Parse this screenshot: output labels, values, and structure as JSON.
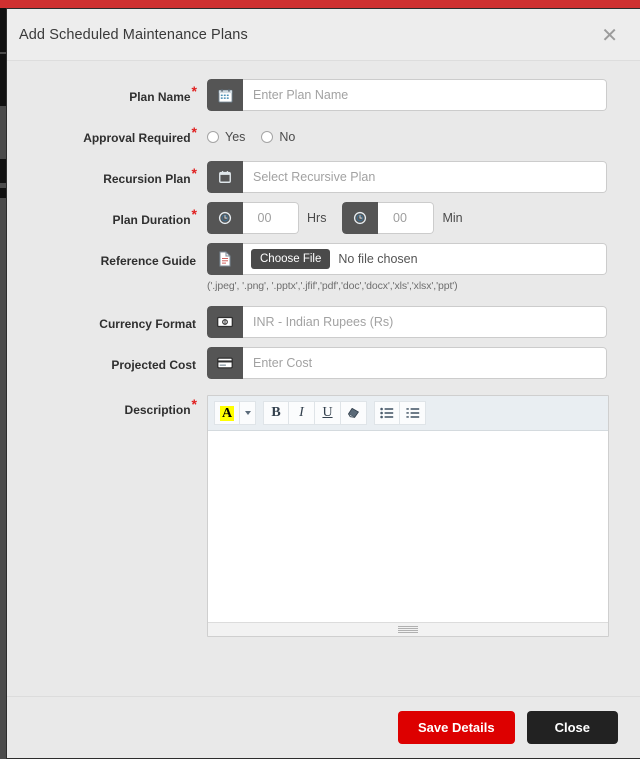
{
  "window": {
    "accent_color": "#cf3030",
    "modal_bg": "#e9e9e9"
  },
  "header": {
    "title": "Add Scheduled Maintenance Plans",
    "close_icon": "close-icon",
    "close_glyph": "✕"
  },
  "form": {
    "plan_name": {
      "label": "Plan Name",
      "required": "*",
      "icon": "calendar-icon",
      "placeholder": "Enter Plan Name",
      "value": ""
    },
    "approval_required": {
      "label": "Approval Required",
      "required": "*",
      "options": [
        {
          "label": "Yes",
          "selected": false
        },
        {
          "label": "No",
          "selected": false
        }
      ]
    },
    "recursion_plan": {
      "label": "Recursion Plan",
      "required": "*",
      "icon": "calendar-icon",
      "placeholder": "Select Recursive Plan",
      "value": ""
    },
    "plan_duration": {
      "label": "Plan Duration",
      "required": "*",
      "hours": {
        "icon": "clock-icon",
        "value": "00",
        "unit": "Hrs"
      },
      "minutes": {
        "icon": "clock-icon",
        "value": "00",
        "unit": "Min"
      }
    },
    "reference_guide": {
      "label": "Reference Guide",
      "required": "",
      "icon": "document-icon",
      "choose_button": "Choose File",
      "file_status": "No file chosen",
      "hint": "('.jpeg', '.png', '.pptx','.jfif','pdf','doc','docx','xls','xlsx','ppt')"
    },
    "currency_format": {
      "label": "Currency Format",
      "required": "",
      "icon": "money-bill-icon",
      "value": "INR - Indian Rupees (Rs)"
    },
    "projected_cost": {
      "label": "Projected Cost",
      "required": "",
      "icon": "credit-card-icon",
      "placeholder": "Enter Cost",
      "value": ""
    },
    "description": {
      "label": "Description",
      "required": "*",
      "content": "",
      "toolbar": [
        {
          "name": "font-color-icon",
          "glyph": "A",
          "title": "Font Color"
        },
        {
          "name": "chevron-down-icon",
          "glyph": "",
          "title": "Font Color Options"
        },
        {
          "name": "bold-icon",
          "glyph": "B",
          "title": "Bold"
        },
        {
          "name": "italic-icon",
          "glyph": "I",
          "title": "Italic"
        },
        {
          "name": "underline-icon",
          "glyph": "U",
          "title": "Underline"
        },
        {
          "name": "remove-format-icon",
          "glyph": "",
          "title": "Remove Format"
        },
        {
          "name": "unordered-list-icon",
          "glyph": "",
          "title": "Bulleted List"
        },
        {
          "name": "ordered-list-icon",
          "glyph": "",
          "title": "Numbered List"
        }
      ]
    }
  },
  "footer": {
    "save_label": "Save Details",
    "close_label": "Close",
    "save_color": "#dd0000",
    "close_color": "#222222"
  }
}
